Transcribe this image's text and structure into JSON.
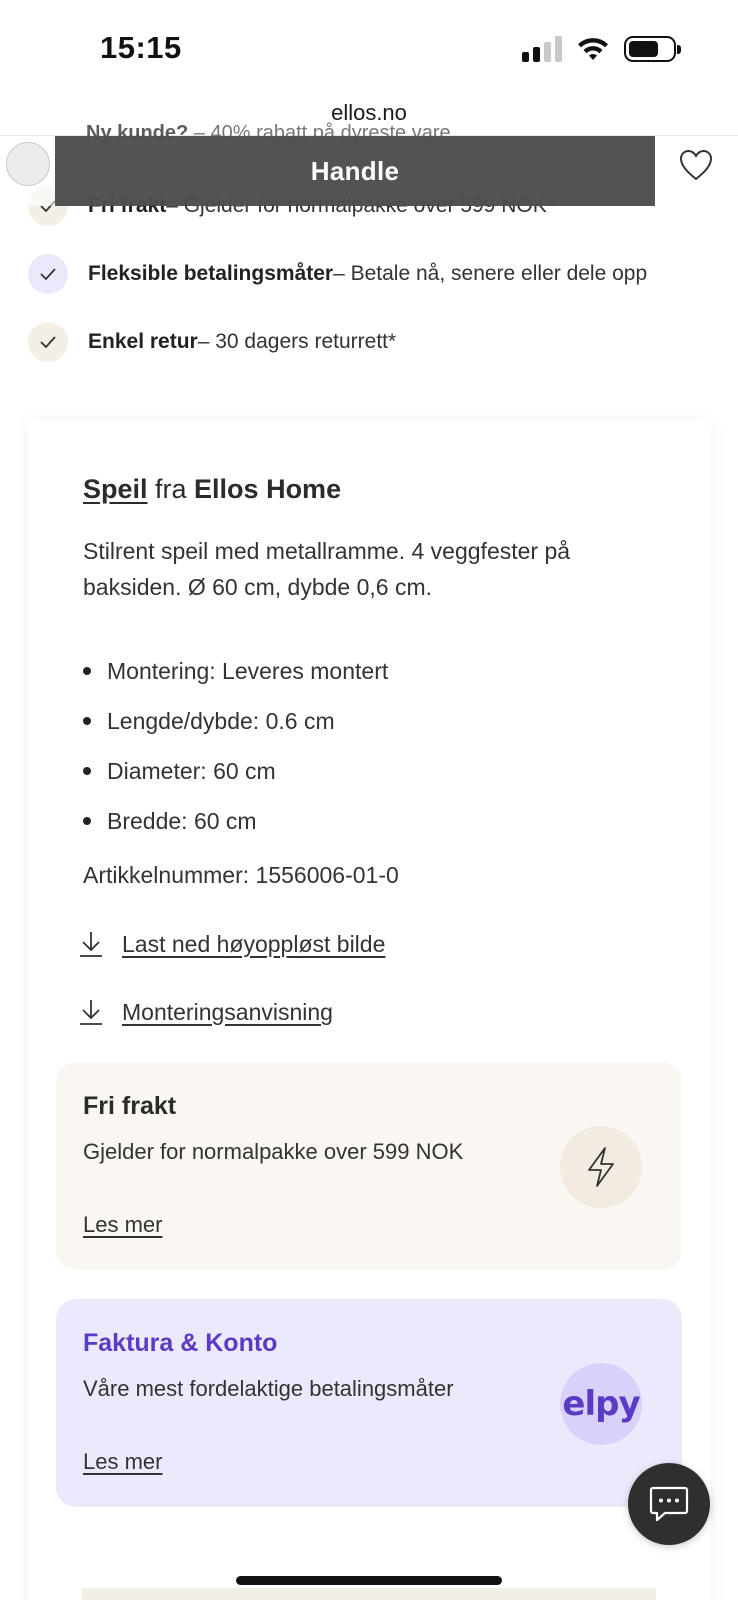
{
  "status_bar": {
    "time": "15:15"
  },
  "browser": {
    "url": "ellos.no"
  },
  "peek": {
    "bold": "Ny kunde?",
    "text": " – 40% rabatt på dyreste vare"
  },
  "sticky": {
    "buy_label": "Handle"
  },
  "usps": [
    {
      "bold": "Fri frakt",
      "text": " – Gjelder for normalpakke over 599 NOK*",
      "style": "beige"
    },
    {
      "bold": "Fleksible betalingsmåter",
      "text": " – Betale nå, senere eller dele opp",
      "style": "lilac"
    },
    {
      "bold": "Enkel retur",
      "text": " – 30 dagers returrett*",
      "style": "beige"
    }
  ],
  "product": {
    "type_link": "Speil",
    "from": " fra ",
    "brand": "Ellos Home",
    "description": "Stilrent speil med metallramme. 4 veggfester på baksiden. Ø 60 cm, dybde 0,6 cm.",
    "specs": [
      "Montering: Leveres montert",
      "Lengde/dybde: 0.6 cm",
      "Diameter: 60 cm",
      "Bredde: 60 cm"
    ],
    "article_number": "Artikkelnummer: 1556006-01-0",
    "download_links": [
      "Last ned høyoppløst bilde",
      "Monteringsanvisning"
    ]
  },
  "boxes": {
    "frakt": {
      "title": "Fri frakt",
      "text": "Gjelder for normalpakke over 599 NOK",
      "link": "Les mer",
      "icon": "lightning-icon"
    },
    "faktura": {
      "title": "Faktura & Konto",
      "text": "Våre mest fordelaktige betalingsmåter",
      "link": "Les mer",
      "logo": "elpy"
    }
  },
  "colors": {
    "accent_purple": "#5b3bc4",
    "dark_button": "#444444",
    "beige_box": "#faf6f1",
    "lilac_box": "#ebe9fc"
  }
}
